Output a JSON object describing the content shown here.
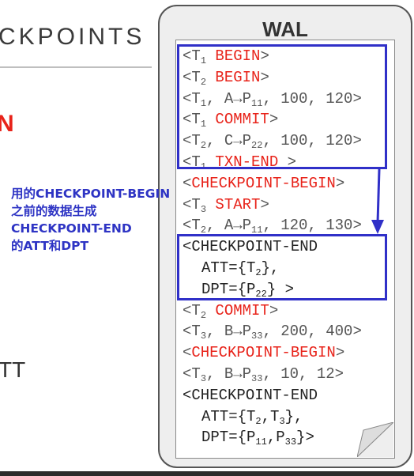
{
  "slide": {
    "title_fragment": "CKPOINTS",
    "red_fragment": "N",
    "lower_fragment": "TT"
  },
  "wal": {
    "title": "WAL",
    "lines": [
      {
        "open": "<T",
        "sub": "1",
        "kw": "BEGIN",
        "close": ">"
      },
      {
        "open": "<T",
        "sub": "2",
        "kw": "BEGIN",
        "close": ">"
      },
      {
        "text": "<T",
        "sub1": "1",
        "mid": ", A→P",
        "sub2": "11",
        "rest": ", 100, 120>"
      },
      {
        "open": "<T",
        "sub": "1",
        "kw": "COMMIT",
        "close": ">"
      },
      {
        "text": "<T",
        "sub1": "2",
        "mid": ", C→P",
        "sub2": "22",
        "rest": ", 100, 120>"
      },
      {
        "open": "<T",
        "sub": "1",
        "kw": "TXN-END",
        "close": " >"
      },
      {
        "open": "<",
        "kw": "CHECKPOINT-BEGIN",
        "close": ">"
      },
      {
        "open": "<T",
        "sub": "3",
        "kw": "START",
        "close": ">"
      },
      {
        "text": "<T",
        "sub1": "2",
        "mid": ", A→P",
        "sub2": "11",
        "rest": ", 120, 130>"
      },
      {
        "plain": "<CHECKPOINT-END"
      },
      {
        "plain": "ATT={T",
        "sub": "2",
        "tail": "},"
      },
      {
        "plain": "DPT={P",
        "sub": "22",
        "tail": "} >"
      },
      {
        "open": "<T",
        "sub": "2",
        "kw": "COMMIT",
        "close": ">"
      },
      {
        "text": "<T",
        "sub1": "3",
        "mid": ", B→P",
        "sub2": "33",
        "rest": ", 200, 400>"
      },
      {
        "open": "<",
        "kw": "CHECKPOINT-BEGIN",
        "close": ">"
      },
      {
        "text": "<T",
        "sub1": "3",
        "mid": ", B→P",
        "sub2": "33",
        "rest": ", 10, 12>"
      },
      {
        "plain": "<CHECKPOINT-END"
      },
      {
        "plain": "ATT={T",
        "sub": "2",
        "tail": ",T",
        "sub2": "3",
        "tail2": "},"
      },
      {
        "plain": "DPT={P",
        "sub": "11",
        "tail": ",P",
        "sub2": "33",
        "tail2": "}>"
      }
    ]
  },
  "annotation": {
    "lines": [
      "用的CHECKPOINT-BEGIN",
      "之前的数据生成",
      "CHECKPOINT-END",
      "的ATT和DPT"
    ]
  },
  "colors": {
    "keyword_red": "#e8231a",
    "highlight_blue": "#3030c8"
  }
}
